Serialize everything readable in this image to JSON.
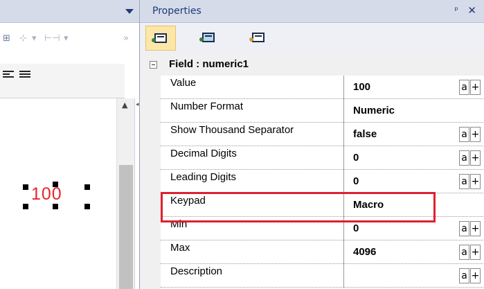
{
  "properties_panel": {
    "title": "Properties",
    "pin_glyph": "ᵖ",
    "close_glyph": "✕"
  },
  "designer_toolbar": {
    "more_glyph": "»"
  },
  "canvas": {
    "numeric_widget_value": "100"
  },
  "category": {
    "label": "Field : numeric1"
  },
  "rows": [
    {
      "name": "Value",
      "value": "100",
      "btn_a": "a",
      "btn_plus": "+"
    },
    {
      "name": "Number Format",
      "value": "Numeric"
    },
    {
      "name": "Show Thousand Separator",
      "value": "false",
      "btn_a": "a",
      "btn_plus": "+"
    },
    {
      "name": "Decimal Digits",
      "value": "0",
      "btn_a": "a",
      "btn_plus": "+"
    },
    {
      "name": "Leading Digits",
      "value": "0",
      "btn_a": "a",
      "btn_plus": "+"
    },
    {
      "name": "Keypad",
      "value": "Macro"
    },
    {
      "name": "Min",
      "value": "0",
      "btn_a": "a",
      "btn_plus": "+"
    },
    {
      "name": "Max",
      "value": "4096",
      "btn_a": "a",
      "btn_plus": "+"
    },
    {
      "name": "Description",
      "value": "",
      "btn_a": "a",
      "btn_plus": "+"
    }
  ],
  "colors": {
    "title_bar": "#d6dbe9",
    "title_text": "#1f3a78",
    "highlight_box": "#e01f2e",
    "widget_value": "#e8242a"
  }
}
